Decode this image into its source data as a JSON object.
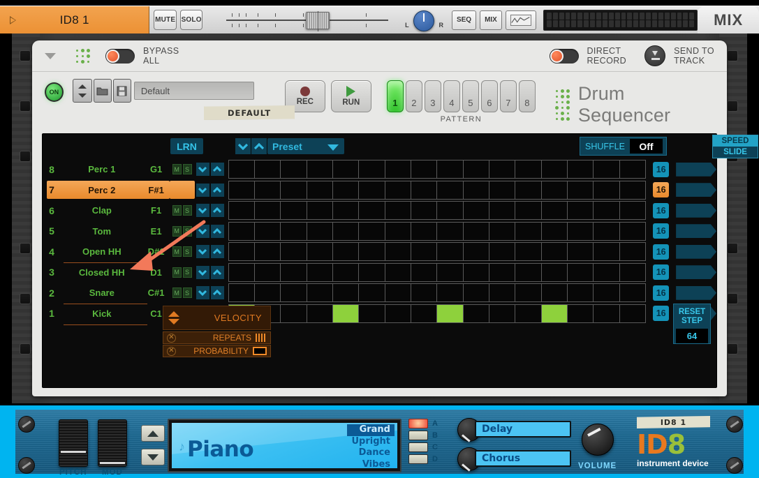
{
  "track_header": {
    "track_name": "ID8 1",
    "mute_label": "MUTE",
    "solo_label": "SOLO",
    "pan_left": "L",
    "pan_right": "R",
    "seq_label": "SEQ",
    "mix_label": "MIX",
    "mix_tab_label": "MIX"
  },
  "panel_top": {
    "bypass_label_line1": "BYPASS",
    "bypass_label_line2": "ALL",
    "direct_record_line1": "DIRECT",
    "direct_record_line2": "RECORD",
    "send_to_track_line1": "SEND TO",
    "send_to_track_line2": "TRACK"
  },
  "preset_row": {
    "on_label": "ON",
    "patch_name": "Default",
    "tape_label": "DEFAULT",
    "rec_label": "REC",
    "run_label": "RUN",
    "pattern_label": "PATTERN",
    "patterns": [
      "1",
      "2",
      "3",
      "4",
      "5",
      "6",
      "7",
      "8"
    ],
    "active_pattern": "1",
    "device_name": "Drum Sequencer"
  },
  "sequencer": {
    "lrn_label": "LRN",
    "preset_label": "Preset",
    "shuffle_label": "SHUFFLE",
    "shuffle_value": "Off",
    "speed_label": "SPEED",
    "slide_label": "SLIDE",
    "velocity_label": "VELOCITY",
    "repeats_label": "REPEATS",
    "probability_label": "PROBABILITY",
    "reset_step_line1": "RESET",
    "reset_step_line2": "STEP",
    "reset_step_value": "64",
    "mute_key": "M",
    "solo_key": "S",
    "selected_row_index": 1,
    "rows": [
      {
        "num": "8",
        "name": "Perc 1",
        "note": "G1",
        "steps": "16",
        "selected": false,
        "underline": false,
        "cells": [
          0,
          0,
          0,
          0,
          0,
          0,
          0,
          0,
          0,
          0,
          0,
          0,
          0,
          0,
          0,
          0
        ]
      },
      {
        "num": "7",
        "name": "Perc 2",
        "note": "F#1",
        "steps": "16",
        "selected": true,
        "underline": false,
        "cells": [
          0,
          0,
          0,
          0,
          0,
          0,
          0,
          0,
          0,
          0,
          0,
          0,
          0,
          0,
          0,
          0
        ]
      },
      {
        "num": "6",
        "name": "Clap",
        "note": "F1",
        "steps": "16",
        "selected": false,
        "underline": false,
        "cells": [
          0,
          0,
          0,
          0,
          0,
          0,
          0,
          0,
          0,
          0,
          0,
          0,
          0,
          0,
          0,
          0
        ]
      },
      {
        "num": "5",
        "name": "Tom",
        "note": "E1",
        "steps": "16",
        "selected": false,
        "underline": false,
        "cells": [
          0,
          0,
          0,
          0,
          0,
          0,
          0,
          0,
          0,
          0,
          0,
          0,
          0,
          0,
          0,
          0
        ]
      },
      {
        "num": "4",
        "name": "Open HH",
        "note": "D#1",
        "steps": "16",
        "selected": false,
        "underline": true,
        "cells": [
          0,
          0,
          0,
          0,
          0,
          0,
          0,
          0,
          0,
          0,
          0,
          0,
          0,
          0,
          0,
          0
        ]
      },
      {
        "num": "3",
        "name": "Closed HH",
        "note": "D1",
        "steps": "16",
        "selected": false,
        "underline": false,
        "cells": [
          0,
          0,
          0,
          0,
          0,
          0,
          0,
          0,
          0,
          0,
          0,
          0,
          0,
          0,
          0,
          0
        ]
      },
      {
        "num": "2",
        "name": "Snare",
        "note": "C#1",
        "steps": "16",
        "selected": false,
        "underline": true,
        "cells": [
          0,
          0,
          0,
          0,
          0,
          0,
          0,
          0,
          0,
          0,
          0,
          0,
          0,
          0,
          0,
          0
        ]
      },
      {
        "num": "1",
        "name": "Kick",
        "note": "C1",
        "steps": "16",
        "selected": false,
        "underline": true,
        "cells": [
          1,
          0,
          0,
          0,
          1,
          0,
          0,
          0,
          1,
          0,
          0,
          0,
          1,
          0,
          0,
          0
        ]
      }
    ]
  },
  "id8_device": {
    "pitch_label": "PITCH",
    "mod_label": "MOD",
    "instrument_name": "Piano",
    "variations": [
      "Grand",
      "Upright",
      "Dance",
      "Vibes"
    ],
    "selected_variation": "Grand",
    "bank_labels": [
      "A",
      "B",
      "C",
      "D"
    ],
    "lit_bank": "A",
    "fx_slot_1": "Delay",
    "fx_slot_2": "Chorus",
    "volume_label": "VOLUME",
    "tape_label": "ID8 1",
    "logo_text_orange": "ID",
    "logo_text_green": "8",
    "logo_sub": "instrument device"
  },
  "colors": {
    "accent_orange": "#ec9134",
    "grid_active_green": "#8ed13c",
    "sequencer_blue": "#1493b8",
    "device_blue": "#00b4f0"
  }
}
